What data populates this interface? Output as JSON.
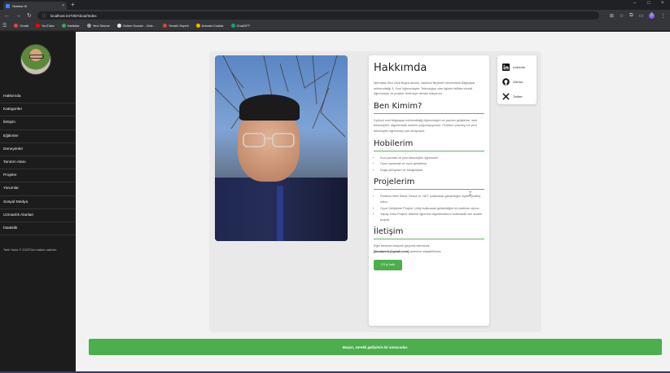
{
  "browser": {
    "tab_title": "Sidebar III",
    "url": "localhost:44730/About/Index",
    "bookmarks": [
      "Gmail",
      "YouTube",
      "Haritalar",
      "Yeni Sekme",
      "Online Kursler - Vide...",
      "Yemek Sepeti",
      "Ankalar Kodlak",
      "ChatGPT"
    ],
    "bookmark_colors": [
      "#ea4335",
      "#ff0000",
      "#34a853",
      "#9aa0a6",
      "#e8eaed",
      "#d44638",
      "#f4b400",
      "#10a37f"
    ],
    "avatar_letter": "B"
  },
  "sidebar": {
    "items": [
      "Hakkımda",
      "Kategoriler",
      "İletişim",
      "Eğitimler",
      "Deneyimler",
      "Tanıtım Alanı",
      "Projeler",
      "Yorumlar",
      "Sosyal Medya",
      "Uzmanlık Alanları",
      "İstatistik"
    ],
    "footer": "Tarik Yadız © 2025Tüm hakları saklıdır."
  },
  "about": {
    "title": "Hakkımda",
    "intro": "Merhaba! Ben Ümit Buğra deselo, İstanbul Beykent Üniversitesi Bilgisayar mühendisliği 3. Sınıf öğrencisiyim. Teknolojiye olan ilgimle birlikte sürekli öğrenmeye ve projeler üretmeye devam ediyorum.",
    "who_title": "Ben Kimim?",
    "who_text": "Üçüncü sınıf bilgisayar mühendisliği öğrencisiyim ve yazılım geliştirme, web teknolojileri, algoritmalar üzerine yoğunlaşıyorum. Problem çözmeyi ve yeni teknolojiler öğrenmeyi çok seviyorum.",
    "hobbies_title": "Hobilerim",
    "hobbies": [
      "Kod yazmak ve yeni teknolojiler öğrenmek",
      "Oyun oynamak ve oyun geliştirme",
      "Doğa yürüyüleri ve fotoğrafçılık"
    ],
    "projects_title": "Projelerim",
    "projects": [
      "Portfolio Web Sitesi: React ve .NET kullanarak geliştirdiğim kişisel portföy sitesi.",
      "Oyun Geliştirme Projesi: Unity kullanarak geliştirdiğim bir platform oyunu.",
      "Yapay Zeka Projesi: Makine öğrenimi algoritmalarını kullanarak veri analizi projesi."
    ],
    "contact_title": "İletişim",
    "contact_text_before": "Eğer benimle iletişime geçmek isterseniz,",
    "contact_email": "[akadaenis@gmail.com]",
    "contact_text_after": "adresine ulaşabilirsiniz.",
    "cv_button": "CV'yi İndir"
  },
  "social": [
    {
      "label": "LinkedIn",
      "icon": "linkedin-icon"
    },
    {
      "label": "GitHub",
      "icon": "github-icon"
    },
    {
      "label": "Twitter",
      "icon": "x-twitter-icon"
    }
  ],
  "banner": "Başarı, sürekli gelişimin bir sonucudur.",
  "colors": {
    "accent": "#4cae4c",
    "sidebar_bg": "#1c1c1c",
    "page_bg": "#f2f2f2"
  }
}
